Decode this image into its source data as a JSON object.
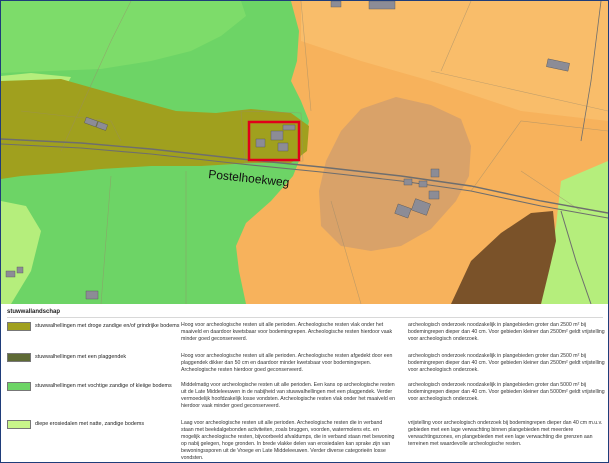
{
  "map": {
    "street_label": "Postelhoekweg",
    "colors": {
      "orange": "#f7b25c",
      "orange_light": "#f9c173",
      "green": "#6dd466",
      "light_green": "#b5ee7c",
      "olive": "#a0a01e",
      "brown_light": "#d9a269",
      "dark_brown": "#7a5229",
      "road": "#777777",
      "building": "#8c8c96",
      "highlight": "#e0001a"
    }
  },
  "legend": {
    "title": "stuwwallandschap",
    "items": [
      {
        "color": "#a0a01e",
        "label": "stuwwalhellingen met droge zandige en/of grindrijke bodems",
        "description": "Hoog voor archeologische resten uit alle perioden. Archeologische resten vlak onder het maaiveld en daardoor kwetsbaar voor bodemingrepen. Archeologische resten hierdoor vaak minder goed geconserveerd.",
        "advice": "archeologisch onderzoek noodzakelijk in plangebieden groter dan 2500 m² bij bodemingrepen dieper dan 40 cm. Voor gebieden kleiner dan 2500m² geldt vrijstelling voor archeologisch onderzoek."
      },
      {
        "color": "#5e6a35",
        "label": "stuwwalhellingen met een plaggendek",
        "description": "Hoog voor archeologische resten uit alle perioden. Archeologische resten afgedekt door een plaggendek dikker dan 50 cm en daardoor minder kwetsbaar voor bodemingrepen. Archeologische resten hierdoor goed geconserveerd.",
        "advice": "archeologisch onderzoek noodzakelijk in plangebieden groter dan 2500 m² bij bodemingrepen dieper dan 40 cm. Voor gebieden kleiner dan 2500m² geldt vrijstelling voor archeologisch onderzoek."
      },
      {
        "color": "#6dd466",
        "label": "stuwwalhellingen met vochtige zandige of kleiige bodems",
        "description": "Middelmatig voor archeologische resten uit alle perioden. Een kans op archeologische resten uit de Late Middeleeuwen in de nabijheid van stuwwalhellingen met een plaggendek. Verder vermoedelijk hoofdzakelijk losse vondsten. Archeologische resten vlak onder het maaiveld en hierdoor vaak minder goed geconserveerd.",
        "advice": "archeologisch onderzoek noodzakelijk in plangebieden groter dan 5000 m² bij bodemingrepen dieper dan 40 cm. Voor gebieden kleiner dan 5000m² geldt vrijstelling voor archeologisch onderzoek."
      },
      {
        "color": "#c8f58a",
        "label": "diepe erosiedalen met natte, zandige bodems",
        "description": "Laag voor archeologische resten uit alle perioden. Archeologische resten die in verband staan met beekdalgebonden activiteiten, zoals bruggen, voorden, watermolens etc. en mogelijk archeologische resten, bijvoorbeeld afvaldumps, die in verband staan met bewoning op nabij gelegen, hoge gronden. In brede vlakke delen van erosiedalen kan sprake zijn van bewoningssporen uit de Vroege en Late Middeleeuwen. Verder diverse categorieën losse vondsten.",
        "advice": "vrijstelling voor archeologisch onderzoek bij bodemingrepen dieper dan 40 cm m.u.v. gebieden met een lage verwachting binnen plangebieden met meerdere verwachtingszones, en plangebieden met een lage verwachting die grenzen aan terreinen met waardevolle archeologische resten."
      }
    ]
  }
}
